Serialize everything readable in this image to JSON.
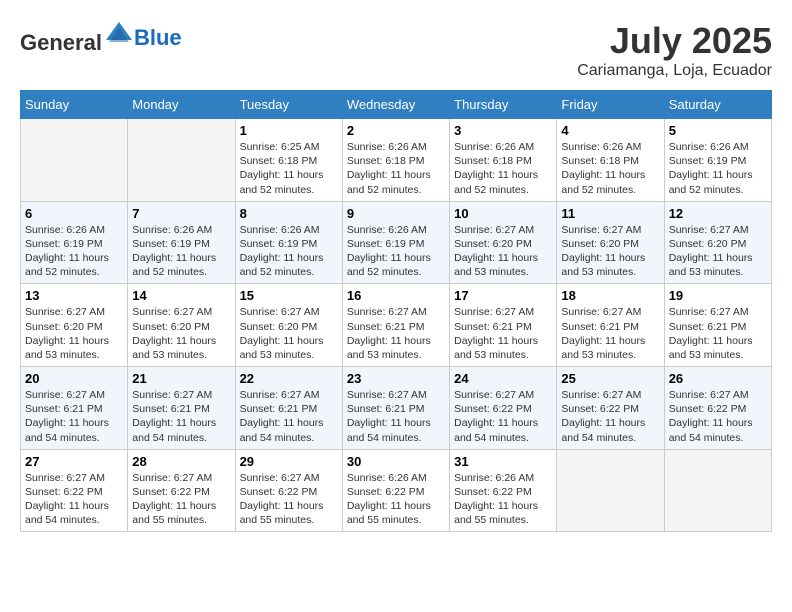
{
  "header": {
    "logo_general": "General",
    "logo_blue": "Blue",
    "month": "July 2025",
    "location": "Cariamanga, Loja, Ecuador"
  },
  "days_of_week": [
    "Sunday",
    "Monday",
    "Tuesday",
    "Wednesday",
    "Thursday",
    "Friday",
    "Saturday"
  ],
  "weeks": [
    [
      {
        "day": "",
        "empty": true
      },
      {
        "day": "",
        "empty": true
      },
      {
        "day": "1",
        "sunrise": "6:25 AM",
        "sunset": "6:18 PM",
        "daylight": "11 hours and 52 minutes."
      },
      {
        "day": "2",
        "sunrise": "6:26 AM",
        "sunset": "6:18 PM",
        "daylight": "11 hours and 52 minutes."
      },
      {
        "day": "3",
        "sunrise": "6:26 AM",
        "sunset": "6:18 PM",
        "daylight": "11 hours and 52 minutes."
      },
      {
        "day": "4",
        "sunrise": "6:26 AM",
        "sunset": "6:18 PM",
        "daylight": "11 hours and 52 minutes."
      },
      {
        "day": "5",
        "sunrise": "6:26 AM",
        "sunset": "6:19 PM",
        "daylight": "11 hours and 52 minutes."
      }
    ],
    [
      {
        "day": "6",
        "sunrise": "6:26 AM",
        "sunset": "6:19 PM",
        "daylight": "11 hours and 52 minutes."
      },
      {
        "day": "7",
        "sunrise": "6:26 AM",
        "sunset": "6:19 PM",
        "daylight": "11 hours and 52 minutes."
      },
      {
        "day": "8",
        "sunrise": "6:26 AM",
        "sunset": "6:19 PM",
        "daylight": "11 hours and 52 minutes."
      },
      {
        "day": "9",
        "sunrise": "6:26 AM",
        "sunset": "6:19 PM",
        "daylight": "11 hours and 52 minutes."
      },
      {
        "day": "10",
        "sunrise": "6:27 AM",
        "sunset": "6:20 PM",
        "daylight": "11 hours and 53 minutes."
      },
      {
        "day": "11",
        "sunrise": "6:27 AM",
        "sunset": "6:20 PM",
        "daylight": "11 hours and 53 minutes."
      },
      {
        "day": "12",
        "sunrise": "6:27 AM",
        "sunset": "6:20 PM",
        "daylight": "11 hours and 53 minutes."
      }
    ],
    [
      {
        "day": "13",
        "sunrise": "6:27 AM",
        "sunset": "6:20 PM",
        "daylight": "11 hours and 53 minutes."
      },
      {
        "day": "14",
        "sunrise": "6:27 AM",
        "sunset": "6:20 PM",
        "daylight": "11 hours and 53 minutes."
      },
      {
        "day": "15",
        "sunrise": "6:27 AM",
        "sunset": "6:20 PM",
        "daylight": "11 hours and 53 minutes."
      },
      {
        "day": "16",
        "sunrise": "6:27 AM",
        "sunset": "6:21 PM",
        "daylight": "11 hours and 53 minutes."
      },
      {
        "day": "17",
        "sunrise": "6:27 AM",
        "sunset": "6:21 PM",
        "daylight": "11 hours and 53 minutes."
      },
      {
        "day": "18",
        "sunrise": "6:27 AM",
        "sunset": "6:21 PM",
        "daylight": "11 hours and 53 minutes."
      },
      {
        "day": "19",
        "sunrise": "6:27 AM",
        "sunset": "6:21 PM",
        "daylight": "11 hours and 53 minutes."
      }
    ],
    [
      {
        "day": "20",
        "sunrise": "6:27 AM",
        "sunset": "6:21 PM",
        "daylight": "11 hours and 54 minutes."
      },
      {
        "day": "21",
        "sunrise": "6:27 AM",
        "sunset": "6:21 PM",
        "daylight": "11 hours and 54 minutes."
      },
      {
        "day": "22",
        "sunrise": "6:27 AM",
        "sunset": "6:21 PM",
        "daylight": "11 hours and 54 minutes."
      },
      {
        "day": "23",
        "sunrise": "6:27 AM",
        "sunset": "6:21 PM",
        "daylight": "11 hours and 54 minutes."
      },
      {
        "day": "24",
        "sunrise": "6:27 AM",
        "sunset": "6:22 PM",
        "daylight": "11 hours and 54 minutes."
      },
      {
        "day": "25",
        "sunrise": "6:27 AM",
        "sunset": "6:22 PM",
        "daylight": "11 hours and 54 minutes."
      },
      {
        "day": "26",
        "sunrise": "6:27 AM",
        "sunset": "6:22 PM",
        "daylight": "11 hours and 54 minutes."
      }
    ],
    [
      {
        "day": "27",
        "sunrise": "6:27 AM",
        "sunset": "6:22 PM",
        "daylight": "11 hours and 54 minutes."
      },
      {
        "day": "28",
        "sunrise": "6:27 AM",
        "sunset": "6:22 PM",
        "daylight": "11 hours and 55 minutes."
      },
      {
        "day": "29",
        "sunrise": "6:27 AM",
        "sunset": "6:22 PM",
        "daylight": "11 hours and 55 minutes."
      },
      {
        "day": "30",
        "sunrise": "6:26 AM",
        "sunset": "6:22 PM",
        "daylight": "11 hours and 55 minutes."
      },
      {
        "day": "31",
        "sunrise": "6:26 AM",
        "sunset": "6:22 PM",
        "daylight": "11 hours and 55 minutes."
      },
      {
        "day": "",
        "empty": true
      },
      {
        "day": "",
        "empty": true
      }
    ]
  ]
}
